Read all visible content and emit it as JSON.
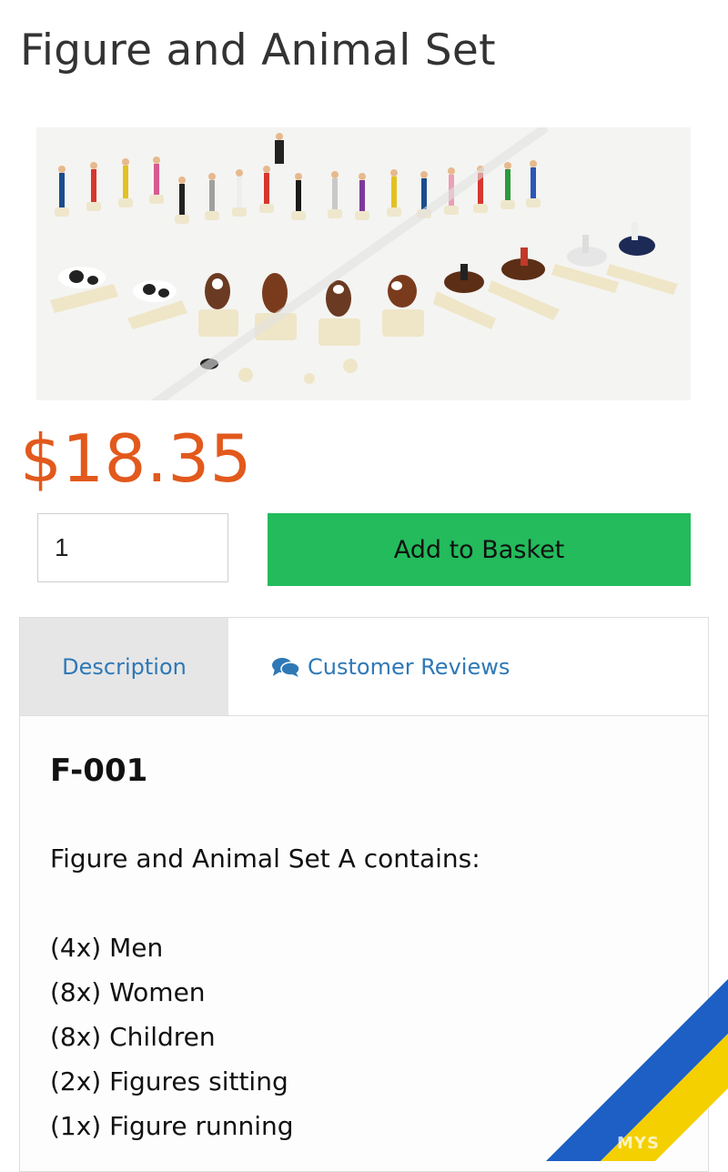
{
  "product": {
    "title": "Figure and Animal Set",
    "image_alt": "Miniature painted figures and animals",
    "price": "$18.35"
  },
  "purchase": {
    "quantity": "1",
    "add_label": "Add to Basket"
  },
  "tabs": {
    "description_label": "Description",
    "reviews_label": "Customer Reviews",
    "reviews_icon": "comments-icon"
  },
  "description": {
    "sku": "F-001",
    "intro": "Figure and Animal Set A contains:",
    "items": [
      "(4x) Men",
      "(8x) Women",
      "(8x) Children",
      "(2x) Figures sitting",
      "(1x) Figure running"
    ]
  },
  "overlay": {
    "watermark": "MYS",
    "flag_colors": [
      "#1d5fc4",
      "#f4d000"
    ]
  },
  "colors": {
    "price": "#e2591c",
    "button": "#23bb5b",
    "link": "#2e78b7"
  }
}
